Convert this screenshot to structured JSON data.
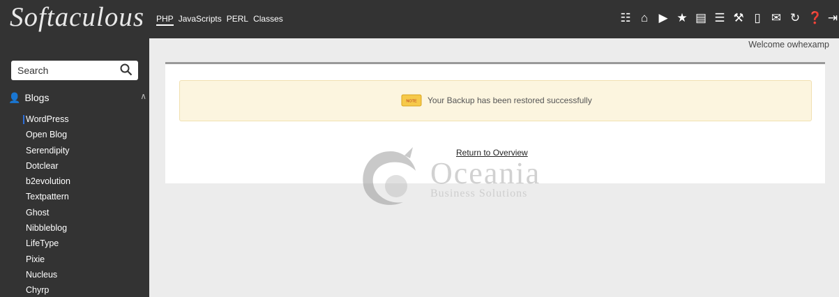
{
  "app": {
    "logo": "Softaculous",
    "welcome": "Welcome owhexamp"
  },
  "topnav": [
    "PHP",
    "JavaScripts",
    "PERL",
    "Classes"
  ],
  "toolbar_icons": [
    "installations-icon",
    "home-icon",
    "play-icon",
    "star-icon",
    "backup-icon",
    "list-icon",
    "wrench-icon",
    "file-icon",
    "mail-icon",
    "refresh-icon",
    "help-icon",
    "logout-icon"
  ],
  "sidebar": {
    "search_label": "Search",
    "category": "Blogs",
    "items": [
      "WordPress",
      "Open Blog",
      "Serendipity",
      "Dotclear",
      "b2evolution",
      "Textpattern",
      "Ghost",
      "Nibbleblog",
      "LifeType",
      "Pixie",
      "Nucleus",
      "Chyrp"
    ]
  },
  "main": {
    "note_badge": "NOTE",
    "message": "Your Backup has been restored successfully",
    "return_link": "Return to Overview"
  },
  "watermark": {
    "name": "Oceania",
    "tagline": "Business Solutions"
  },
  "colors": {
    "sidebar_bg": "#333333",
    "note_bg": "#fcf5df",
    "selected_marker": "#2e6fd9"
  }
}
